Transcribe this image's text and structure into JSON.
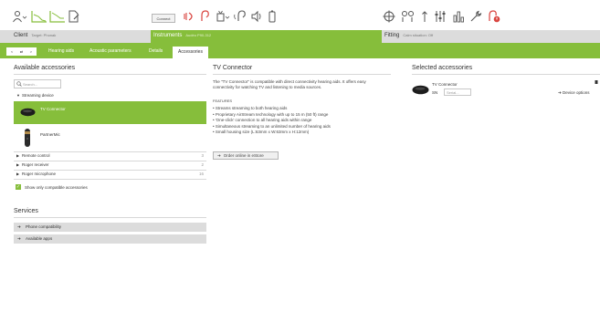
{
  "colors": {
    "accent": "#86be3b",
    "section_gray": "#dcdcdc",
    "icon_gray": "#555555",
    "alert_red": "#d9443f"
  },
  "toolbar": {
    "left_icons": [
      "person-menu-icon",
      "audiogram-icon",
      "audiogram-compare-icon",
      "document-edit-icon"
    ],
    "connect_label": "Connect",
    "instrument_icons": [
      "hearing-aid-connect-red-icon",
      "hearing-aid-red-icon",
      "programming-device-icon",
      "hearing-aid-wireless-icon",
      "speaker-icon",
      "battery-icon"
    ],
    "fitting_icons": [
      "target-icon",
      "couple-icon",
      "single-arrow-icon",
      "sliders-icon",
      "bar-chart-icon",
      "tool-icon",
      "loudness-alert-icon"
    ]
  },
  "sections": {
    "client": {
      "label": "Client",
      "sub": "Target: Phonak"
    },
    "instruments": {
      "label": "Instruments",
      "sub": "Audéo P90-312"
    },
    "fitting": {
      "label": "Fitting",
      "sub": "Calm situation: Off"
    }
  },
  "tabs": {
    "nav": {
      "back": "<",
      "mid": "⇄",
      "forward": ">"
    },
    "items": [
      "Hearing aids",
      "Acoustic parameters",
      "Details",
      "Accessories"
    ],
    "active": "Accessories"
  },
  "available": {
    "title": "Available accessories",
    "search_placeholder": "Search...",
    "streaming_group": "Streaming device",
    "streaming_items": [
      {
        "name": "TV Connector",
        "icon": "tv-connector-icon",
        "selected": true
      },
      {
        "name": "PartnerMic",
        "icon": "partnermic-icon",
        "selected": false
      }
    ],
    "groups": [
      {
        "label": "Remote control",
        "count": "3"
      },
      {
        "label": "Roger receiver",
        "count": "2"
      },
      {
        "label": "Roger microphone",
        "count": "16"
      }
    ],
    "compat_check_label": "Show only compatible accessories",
    "compat_checked": true
  },
  "services": {
    "title": "Services",
    "items": [
      "Phone compatibility",
      "Available apps"
    ]
  },
  "detail": {
    "title": "TV Connector",
    "description": "The \"TV Connector\" is compatible with direct connectivity hearing aids. It offers easy connectivity for watching TV and listening to media sources.",
    "features_label": "FEATURES",
    "features": [
      "Streams streaming to both hearing aids",
      "Proprietary AirStream technology with up to 15 m (50 ft) range",
      "'One-click' connection to all hearing aids within range",
      "Simultaneous streaming to an unlimited number of hearing aids",
      "Small housing size (L:63mm x W:63mm x H:12mm)"
    ],
    "eshop_label": "Order online in eStore"
  },
  "selected": {
    "title": "Selected accessories",
    "item_name": "TV Connector",
    "sn_label": "SN",
    "serial_placeholder": "Serial...",
    "device_options": "Device options"
  }
}
